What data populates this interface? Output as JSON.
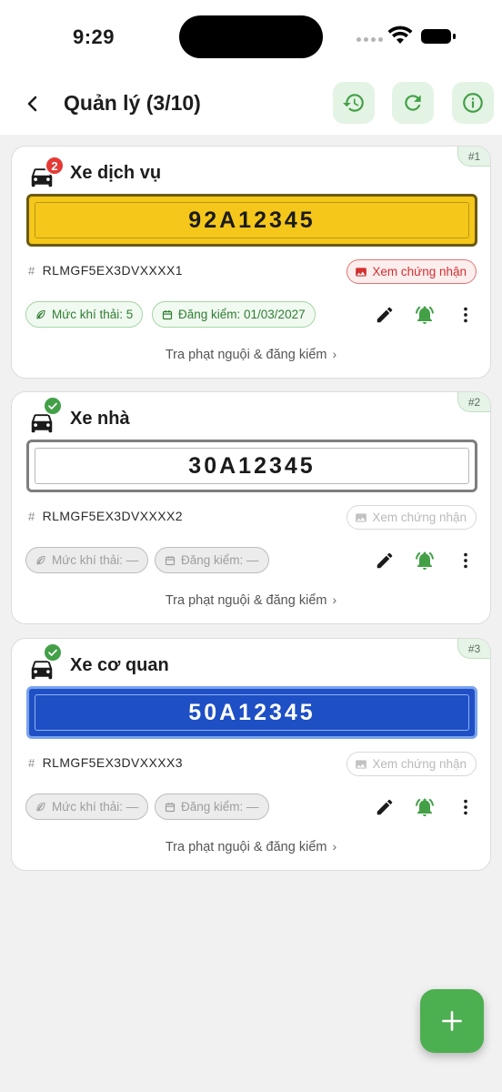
{
  "status_bar": {
    "time": "9:29"
  },
  "header": {
    "title": "Quản lý (3/10)",
    "icons": [
      "back-icon",
      "history-icon",
      "refresh-icon",
      "info-icon"
    ]
  },
  "vehicles": [
    {
      "index_label": "#1",
      "name": "Xe dịch vụ",
      "badge": "2",
      "badge_type": "count",
      "plate": "92A12345",
      "plate_color": "yellow",
      "vin": "RLMGF5EX3DVXXXX1",
      "cert_label": "Xem chứng nhận",
      "cert_active": true,
      "emission_label": "Mức khí thải: 5",
      "inspection_label": "Đăng kiểm: 01/03/2027",
      "lookup_label": "Tra phạt nguội & đăng kiểm"
    },
    {
      "index_label": "#2",
      "name": "Xe nhà",
      "badge": "",
      "badge_type": "check",
      "plate": "30A12345",
      "plate_color": "white",
      "vin": "RLMGF5EX3DVXXXX2",
      "cert_label": "Xem chứng nhận",
      "cert_active": false,
      "emission_label": "Mức khí thải: —",
      "inspection_label": "Đăng kiểm: —",
      "lookup_label": "Tra phạt nguội & đăng kiểm"
    },
    {
      "index_label": "#3",
      "name": "Xe cơ quan",
      "badge": "",
      "badge_type": "check",
      "plate": "50A12345",
      "plate_color": "blue",
      "vin": "RLMGF5EX3DVXXXX3",
      "cert_label": "Xem chứng nhận",
      "cert_active": false,
      "emission_label": "Mức khí thải: —",
      "inspection_label": "Đăng kiểm: —",
      "lookup_label": "Tra phạt nguội & đăng kiểm"
    }
  ],
  "fab": {
    "icon": "plus-icon"
  },
  "colors": {
    "accent_green": "#4caf50",
    "danger_red": "#d32f2f",
    "plate_yellow": "#f5c71a",
    "plate_blue": "#1e4fc4"
  }
}
